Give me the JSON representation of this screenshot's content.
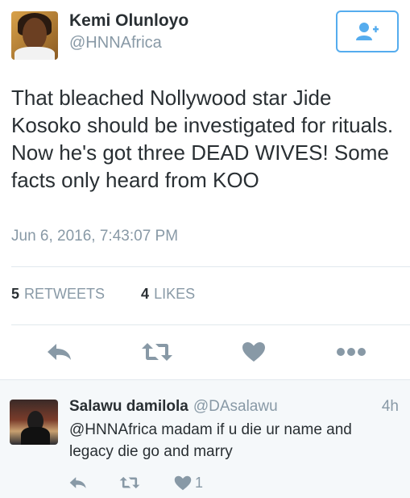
{
  "author": {
    "name": "Kemi Olunloyo",
    "handle": "@HNNAfrica"
  },
  "tweet": {
    "text": "That bleached Nollywood star Jide Kosoko should be investigated for rituals. Now he's got three DEAD WIVES! Some facts only heard from KOO",
    "timestamp": "Jun 6, 2016, 7:43:07 PM"
  },
  "stats": {
    "retweets_count": "5",
    "retweets_label": "RETWEETS",
    "likes_count": "4",
    "likes_label": "LIKES"
  },
  "icons": {
    "follow": "add-user-icon",
    "reply": "reply-icon",
    "retweet": "retweet-icon",
    "like": "heart-icon",
    "more": "more-icon"
  },
  "colors": {
    "accent": "#55acee",
    "muted": "#8899a6",
    "icon": "#8899a6",
    "text": "#292f33"
  },
  "reply": {
    "name": "Salawu damilola",
    "handle": "@DAsalawu",
    "time": "4h",
    "text": "@HNNAfrica  madam if u die ur name and legacy die go and marry",
    "likes_count": "1"
  }
}
